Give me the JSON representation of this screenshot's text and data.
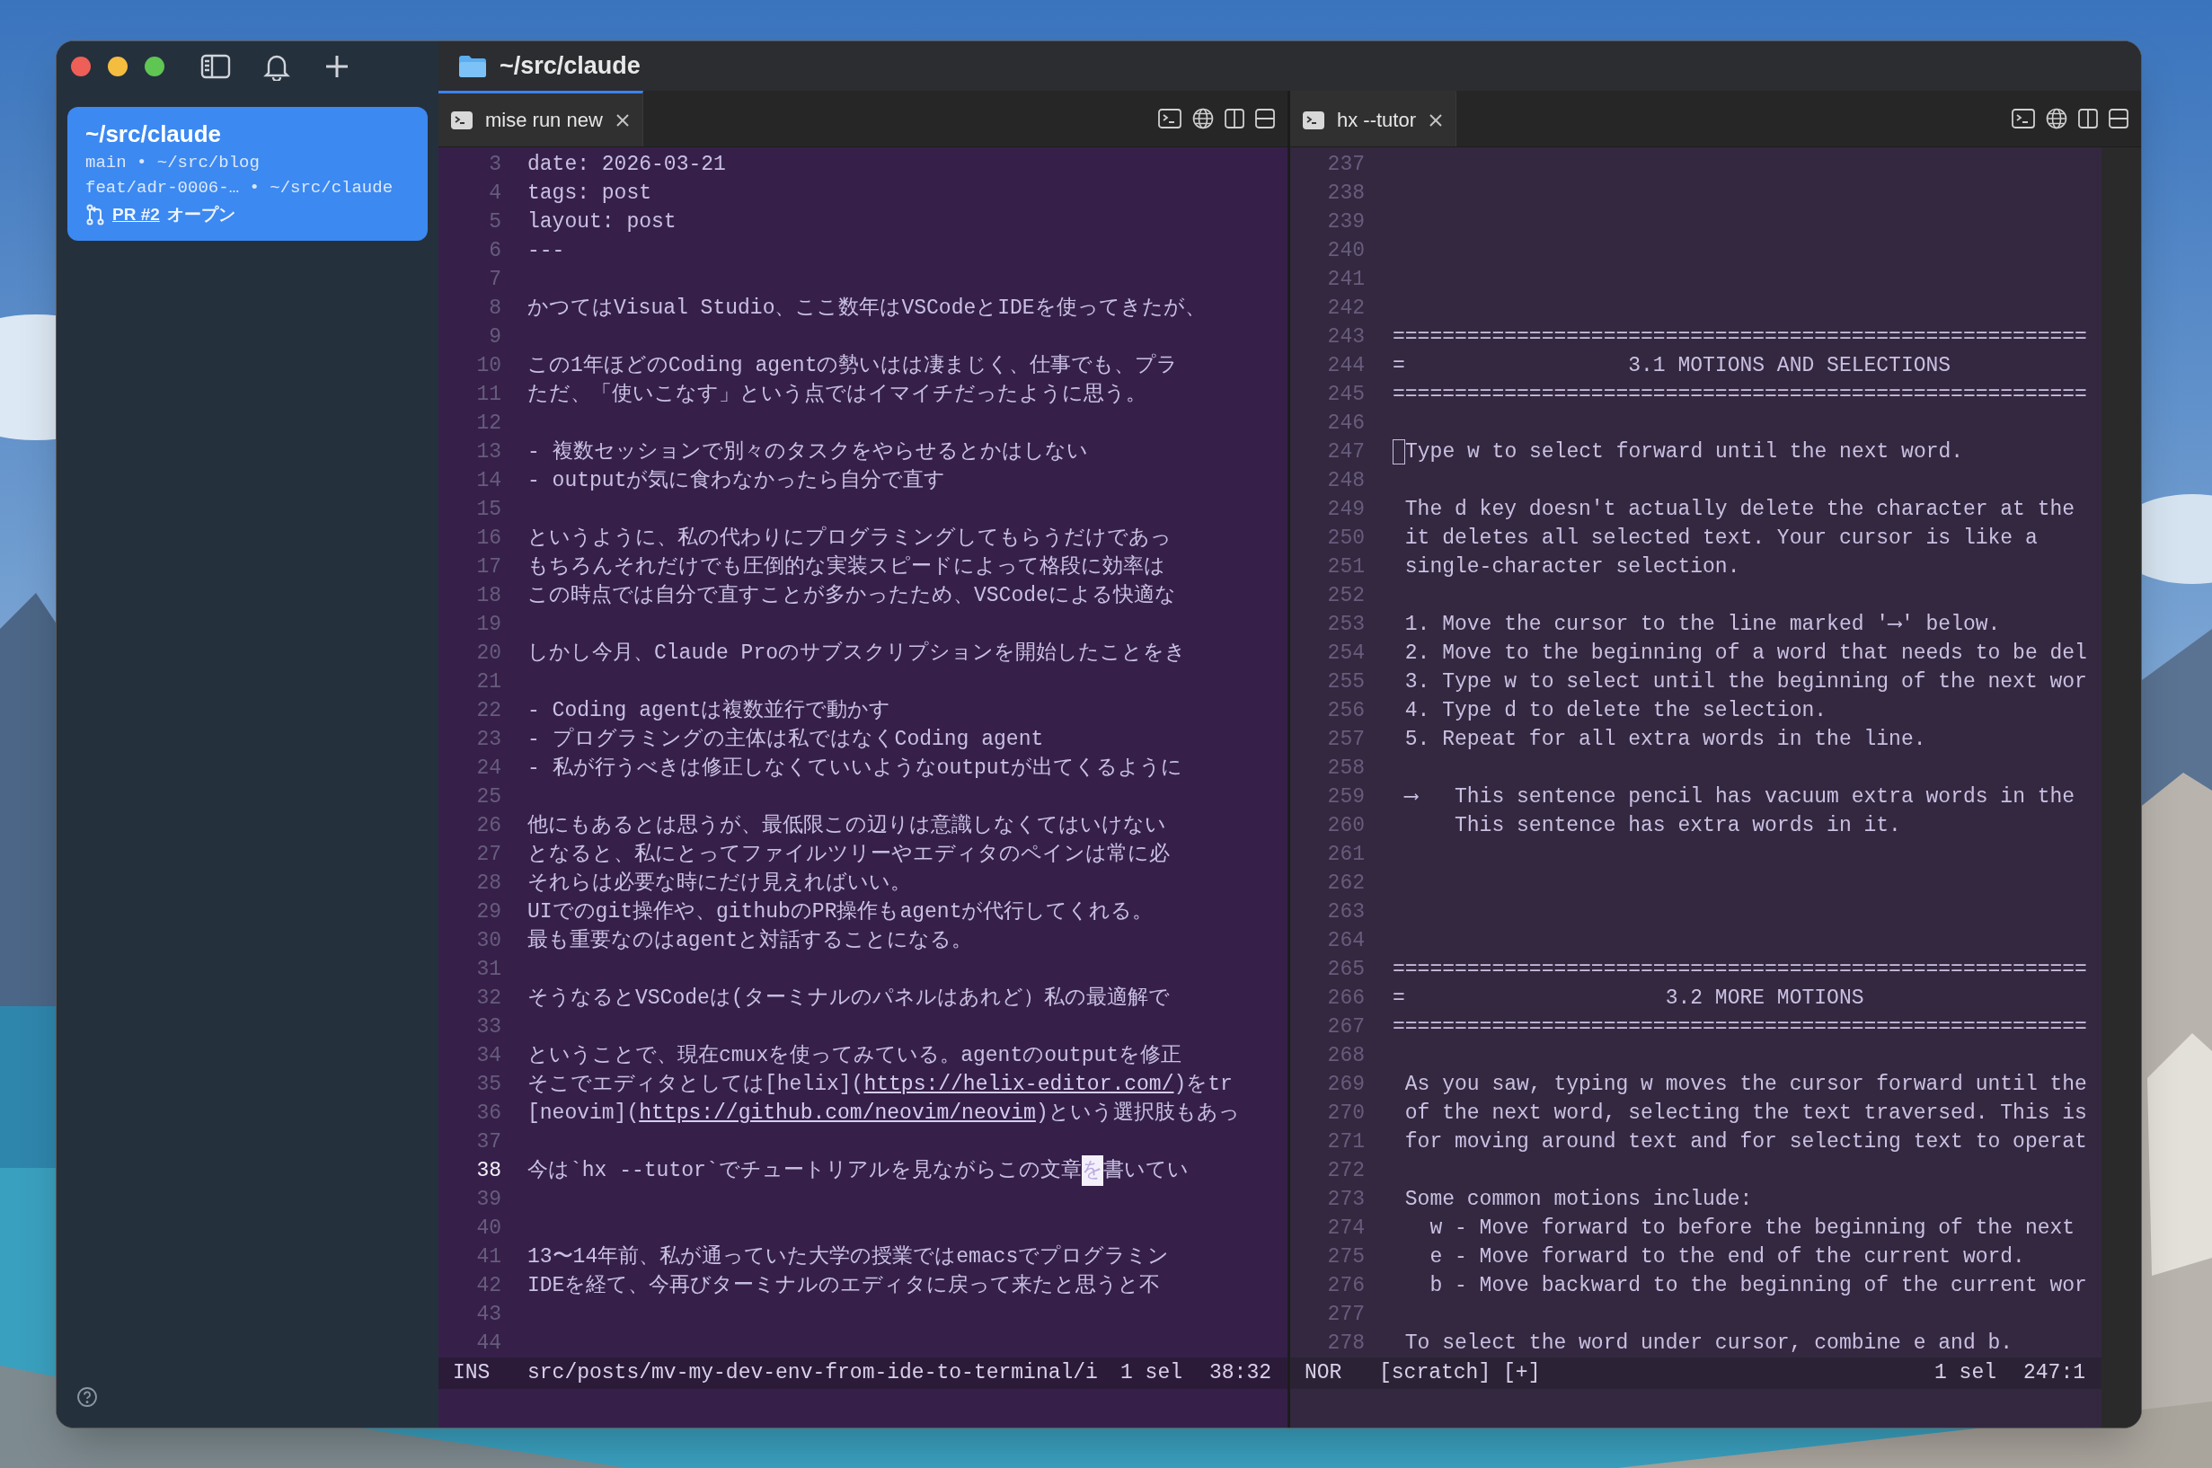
{
  "window": {
    "title": "~/src/claude"
  },
  "sidebar": {
    "workspaces": [
      {
        "title": "~/src/claude",
        "selected": true,
        "branches": [
          "main • ~/src/blog",
          "feat/adr-0006-… • ~/src/claude"
        ],
        "pr": {
          "link": "PR #2",
          "status": "オープン"
        }
      }
    ]
  },
  "panes": [
    {
      "focused": true,
      "tabs": [
        {
          "label": "mise run new",
          "selected": true
        }
      ],
      "lines": [
        {
          "n": "3",
          "current": false,
          "text": "date: 2026-03-21"
        },
        {
          "n": "4",
          "current": false,
          "text": "tags: post"
        },
        {
          "n": "5",
          "current": false,
          "text": "layout: post"
        },
        {
          "n": "6",
          "current": false,
          "text": "---"
        },
        {
          "n": "7",
          "current": false
        },
        {
          "n": "8",
          "current": false,
          "text": "かつてはVisual Studio、ここ数年はVSCodeとIDEを使ってきたが、"
        },
        {
          "n": "9",
          "current": false
        },
        {
          "n": "10",
          "current": false,
          "text": "この1年ほどのCoding agentの勢いはは凄まじく、仕事でも、プラ"
        },
        {
          "n": "11",
          "current": false,
          "text": "ただ、「使いこなす」という点ではイマイチだったように思う。"
        },
        {
          "n": "12",
          "current": false
        },
        {
          "n": "13",
          "current": false,
          "text": "- 複数セッションで別々のタスクをやらせるとかはしない"
        },
        {
          "n": "14",
          "current": false,
          "text": "- outputが気に食わなかったら自分で直す"
        },
        {
          "n": "15",
          "current": false
        },
        {
          "n": "16",
          "current": false,
          "text": "というように、私の代わりにプログラミングしてもらうだけであっ"
        },
        {
          "n": "17",
          "current": false,
          "text": "もちろんそれだけでも圧倒的な実装スピードによって格段に効率は"
        },
        {
          "n": "18",
          "current": false,
          "text": "この時点では自分で直すことが多かったため、VSCodeによる快適な"
        },
        {
          "n": "19",
          "current": false
        },
        {
          "n": "20",
          "current": false,
          "text": "しかし今月、Claude Proのサブスクリプションを開始したことをき"
        },
        {
          "n": "21",
          "current": false
        },
        {
          "n": "22",
          "current": false,
          "text": "- Coding agentは複数並行で動かす"
        },
        {
          "n": "23",
          "current": false,
          "text": "- プログラミングの主体は私ではなくCoding agent"
        },
        {
          "n": "24",
          "current": false,
          "text": "- 私が行うべきは修正しなくていいようなoutputが出てくるように"
        },
        {
          "n": "25",
          "current": false
        },
        {
          "n": "26",
          "current": false,
          "text": "他にもあるとは思うが、最低限この辺りは意識しなくてはいけない"
        },
        {
          "n": "27",
          "current": false,
          "text": "となると、私にとってファイルツリーやエディタのペインは常に必"
        },
        {
          "n": "28",
          "current": false,
          "text": "それらは必要な時にだけ見えればいい。"
        },
        {
          "n": "29",
          "current": false,
          "text": "UIでのgit操作や、githubのPR操作もagentが代行してくれる。"
        },
        {
          "n": "30",
          "current": false,
          "text": "最も重要なのはagentと対話することになる。"
        },
        {
          "n": "31",
          "current": false
        },
        {
          "n": "32",
          "current": false,
          "text": "そうなるとVSCodeは(ターミナルのパネルはあれど）私の最適解で"
        },
        {
          "n": "33",
          "current": false
        },
        {
          "n": "34",
          "current": false,
          "text": "ということで、現在cmuxを使ってみている。agentのoutputを修正"
        },
        {
          "n": "35",
          "current": false,
          "segments": [
            {
              "kind": "text",
              "text": "そこでエディタとしては[helix]("
            },
            {
              "kind": "link",
              "text": "https://helix-editor.com/"
            },
            {
              "kind": "text",
              "text": ")をtr"
            }
          ]
        },
        {
          "n": "36",
          "current": false,
          "segments": [
            {
              "kind": "text",
              "text": "[neovim]("
            },
            {
              "kind": "link",
              "text": "https://github.com/neovim/neovim"
            },
            {
              "kind": "text",
              "text": ")という選択肢もあっ"
            }
          ]
        },
        {
          "n": "37",
          "current": false
        },
        {
          "n": "38",
          "current": true,
          "segments": [
            {
              "kind": "text",
              "text": "今は`hx --tutor`でチュートリアルを見ながらこの文章"
            },
            {
              "kind": "cursor",
              "text": "を"
            },
            {
              "kind": "text",
              "text": "書いてい"
            }
          ]
        },
        {
          "n": "39",
          "current": false
        },
        {
          "n": "40",
          "current": false
        },
        {
          "n": "41",
          "current": false,
          "text": "13〜14年前、私が通っていた大学の授業ではemacsでプログラミン"
        },
        {
          "n": "42",
          "current": false,
          "text": "IDEを経て、今再びターミナルのエディタに戻って来たと思うと不"
        },
        {
          "n": "43",
          "current": false
        },
        {
          "n": "44",
          "current": false
        }
      ],
      "status": {
        "mode": "INS",
        "file": "src/posts/mv-my-dev-env-from-ide-to-terminal/i",
        "selections": "1 sel",
        "position": "38:32"
      }
    },
    {
      "focused": false,
      "tabs": [
        {
          "label": "hx --tutor",
          "selected": true
        }
      ],
      "lines": [
        {
          "n": "237",
          "current": false
        },
        {
          "n": "238",
          "current": false
        },
        {
          "n": "239",
          "current": false
        },
        {
          "n": "240",
          "current": false
        },
        {
          "n": "241",
          "current": false
        },
        {
          "n": "242",
          "current": false
        },
        {
          "n": "243",
          "current": false,
          "text": "========================================================"
        },
        {
          "n": "244",
          "current": false,
          "text": "=                  3.1 MOTIONS AND SELECTIONS"
        },
        {
          "n": "245",
          "current": false,
          "text": "========================================================"
        },
        {
          "n": "246",
          "current": false
        },
        {
          "n": "247",
          "current": false,
          "segments": [
            {
              "kind": "block_cursor"
            },
            {
              "kind": "text",
              "text": "Type w to select forward until the next word."
            }
          ]
        },
        {
          "n": "248",
          "current": false
        },
        {
          "n": "249",
          "current": false,
          "text": " The d key doesn't actually delete the character at the"
        },
        {
          "n": "250",
          "current": false,
          "text": " it deletes all selected text. Your cursor is like a"
        },
        {
          "n": "251",
          "current": false,
          "text": " single-character selection."
        },
        {
          "n": "252",
          "current": false
        },
        {
          "n": "253",
          "current": false,
          "text": " 1. Move the cursor to the line marked '⟶' below."
        },
        {
          "n": "254",
          "current": false,
          "text": " 2. Move to the beginning of a word that needs to be del"
        },
        {
          "n": "255",
          "current": false,
          "text": " 3. Type w to select until the beginning of the next wor"
        },
        {
          "n": "256",
          "current": false,
          "text": " 4. Type d to delete the selection."
        },
        {
          "n": "257",
          "current": false,
          "text": " 5. Repeat for all extra words in the line."
        },
        {
          "n": "258",
          "current": false
        },
        {
          "n": "259",
          "current": false,
          "text": " ⟶   This sentence pencil has vacuum extra words in the"
        },
        {
          "n": "260",
          "current": false,
          "text": "     This sentence has extra words in it."
        },
        {
          "n": "261",
          "current": false
        },
        {
          "n": "262",
          "current": false
        },
        {
          "n": "263",
          "current": false
        },
        {
          "n": "264",
          "current": false
        },
        {
          "n": "265",
          "current": false,
          "text": "========================================================"
        },
        {
          "n": "266",
          "current": false,
          "text": "=                     3.2 MORE MOTIONS"
        },
        {
          "n": "267",
          "current": false,
          "text": "========================================================"
        },
        {
          "n": "268",
          "current": false
        },
        {
          "n": "269",
          "current": false,
          "text": " As you saw, typing w moves the cursor forward until the"
        },
        {
          "n": "270",
          "current": false,
          "text": " of the next word, selecting the text traversed. This is"
        },
        {
          "n": "271",
          "current": false,
          "text": " for moving around text and for selecting text to operat"
        },
        {
          "n": "272",
          "current": false
        },
        {
          "n": "273",
          "current": false,
          "text": " Some common motions include:"
        },
        {
          "n": "274",
          "current": false,
          "text": "   w - Move forward to before the beginning of the next"
        },
        {
          "n": "275",
          "current": false,
          "text": "   e - Move forward to the end of the current word."
        },
        {
          "n": "276",
          "current": false,
          "text": "   b - Move backward to the beginning of the current wor"
        },
        {
          "n": "277",
          "current": false
        },
        {
          "n": "278",
          "current": false,
          "text": " To select the word under cursor, combine e and b."
        }
      ],
      "status": {
        "mode": "NOR",
        "file": "[scratch] [+]",
        "selections": "1 sel",
        "position": "247:1"
      }
    }
  ]
}
